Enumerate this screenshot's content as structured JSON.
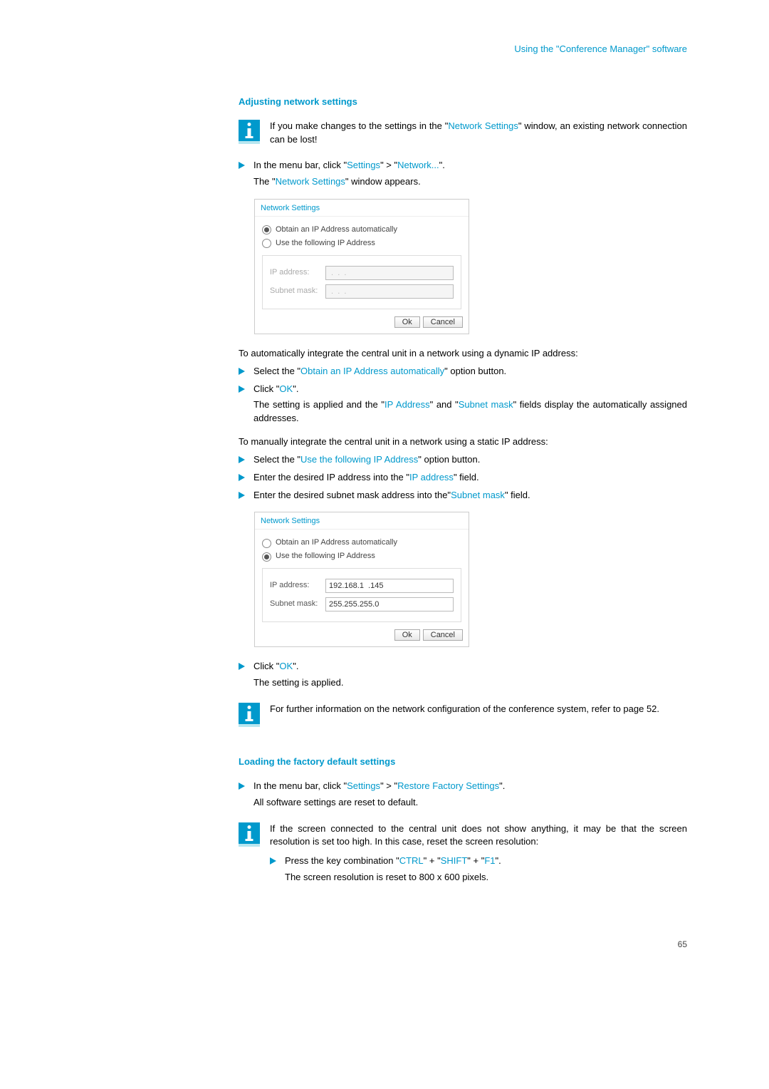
{
  "header": "Using the \"Conference Manager\" software",
  "page_number": "65",
  "s1": {
    "title": "Adjusting network settings",
    "info": {
      "pre": "If you make changes to the settings in the \"",
      "link": "Network Settings",
      "post": "\" window, an existing network connection can be lost!"
    },
    "step1": {
      "pre": "In the menu bar, click \"",
      "link1": "Settings",
      "mid": "\" > \"",
      "link2": "Network...",
      "post": "\".",
      "cont_pre": "The \"",
      "cont_link": "Network Settings",
      "cont_post": "\" window appears."
    },
    "para_auto": "To automatically integrate the central unit in a network using a dynamic IP address:",
    "step_auto1": {
      "pre": "Select the \"",
      "link": "Obtain an IP Address automatically",
      "post": "\" option button."
    },
    "step_auto2": {
      "pre": "Click \"",
      "link": "OK",
      "post": "\".",
      "cont_pre": "The setting is applied and the \"",
      "cont_link1": "IP Address",
      "cont_mid": "\" and \"",
      "cont_link2": "Subnet mask",
      "cont_post": "\" fields display the automatically assigned addresses."
    },
    "para_manual": "To manually integrate the central unit in a network using a static IP address:",
    "step_m1": {
      "pre": "Select the \"",
      "link": "Use the following IP Address",
      "post": "\" option button."
    },
    "step_m2": {
      "pre": "Enter the desired IP address into the \"",
      "link": "IP address",
      "post": "\" field."
    },
    "step_m3": {
      "pre": "Enter the desired subnet mask address into the\"",
      "link": "Subnet mask",
      "post": "\" field."
    },
    "step_apply": {
      "pre": "Click \"",
      "link": "OK",
      "post": "\".",
      "cont": "The setting is applied."
    },
    "info2": "For further information on the network configuration of the conference system, refer to page 52."
  },
  "dialog1": {
    "title": "Network Settings",
    "opt_auto": "Obtain an IP Address automatically",
    "opt_manual": "Use the following IP Address",
    "ip_label": "IP address:",
    "ip_value": " .  .  . ",
    "mask_label": "Subnet mask:",
    "mask_value": " .  .  . ",
    "ok": "Ok",
    "cancel": "Cancel"
  },
  "dialog2": {
    "title": "Network Settings",
    "opt_auto": "Obtain an IP Address automatically",
    "opt_manual": "Use the following IP Address",
    "ip_label": "IP address:",
    "ip_value": "192.168.1  .145",
    "mask_label": "Subnet mask:",
    "mask_value": "255.255.255.0",
    "ok": "Ok",
    "cancel": "Cancel"
  },
  "s2": {
    "title": "Loading the factory default settings",
    "step1": {
      "pre": "In the menu bar, click \"",
      "link1": "Settings",
      "mid": "\" > \"",
      "link2": "Restore Factory Settings",
      "post": "\".",
      "cont": "All software settings are reset to default."
    },
    "info": "If the screen connected to the central unit does not show anything, it may be that the screen resolution is set too high. In this case, reset the screen resolution:",
    "substep": {
      "pre": "Press the key combination \"",
      "l1": "CTRL",
      "m1": "\" + \"",
      "l2": "SHIFT",
      "m2": "\" + \"",
      "l3": "F1",
      "post": "\".",
      "cont": "The screen resolution is reset to 800 x 600 pixels."
    }
  }
}
